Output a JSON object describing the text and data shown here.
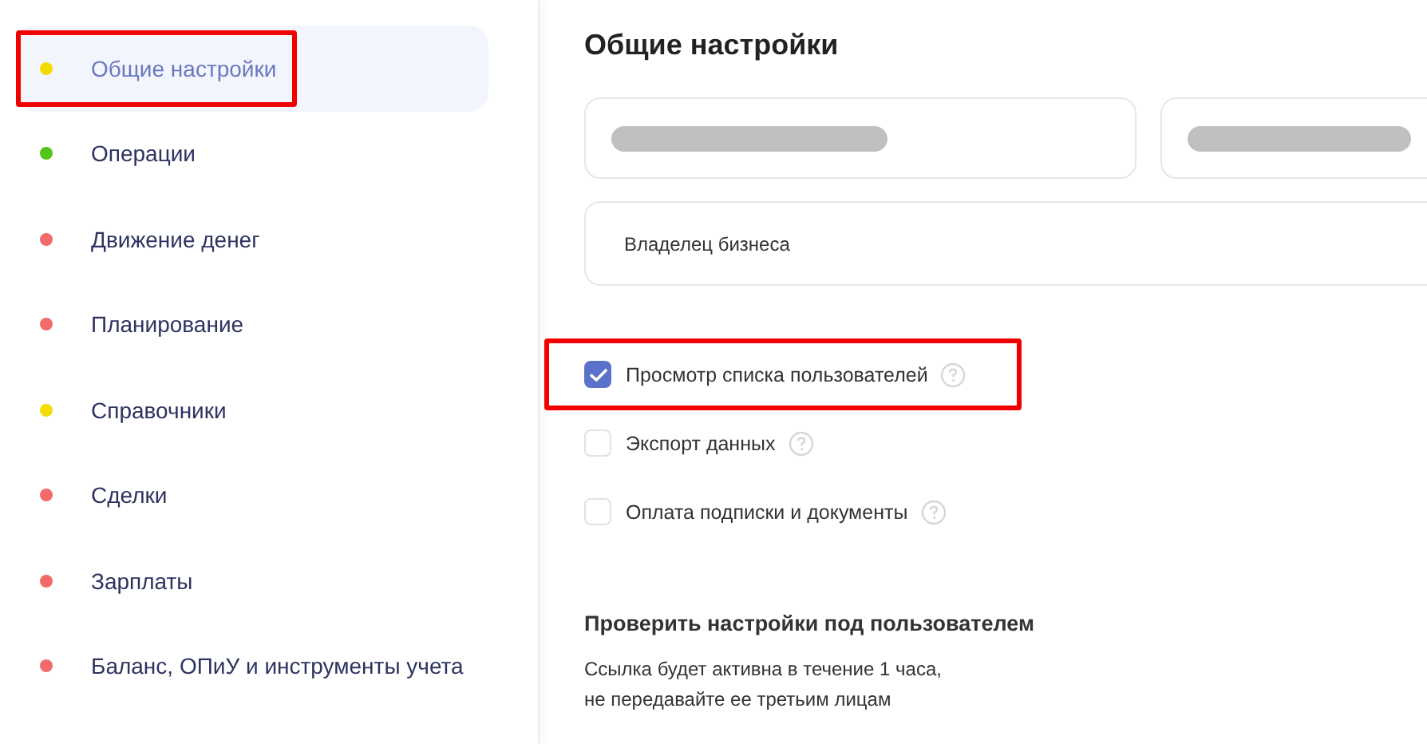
{
  "sidebar": {
    "items": [
      {
        "label": "Общие настройки",
        "color": "#f5dc00",
        "selected": true,
        "highlighted": true
      },
      {
        "label": "Операции",
        "color": "#52c41a",
        "selected": false,
        "highlighted": false
      },
      {
        "label": "Движение денег",
        "color": "#f26b6b",
        "selected": false,
        "highlighted": false
      },
      {
        "label": "Планирование",
        "color": "#f26b6b",
        "selected": false,
        "highlighted": false
      },
      {
        "label": "Справочники",
        "color": "#f5dc00",
        "selected": false,
        "highlighted": false
      },
      {
        "label": "Сделки",
        "color": "#f26b6b",
        "selected": false,
        "highlighted": false
      },
      {
        "label": "Зарплаты",
        "color": "#f26b6b",
        "selected": false,
        "highlighted": false
      },
      {
        "label": "Баланс, ОПиУ и инструменты учета",
        "color": "#f26b6b",
        "selected": false,
        "highlighted": false
      }
    ]
  },
  "main": {
    "title": "Общие настройки",
    "fields": [
      {
        "kind": "loading"
      },
      {
        "kind": "loading"
      },
      {
        "kind": "text",
        "value": "Владелец бизнеса"
      }
    ],
    "permissions": [
      {
        "label": "Просмотр списка пользователей",
        "checked": true,
        "highlighted": true
      },
      {
        "label": "Экспорт данных",
        "checked": false,
        "highlighted": false
      },
      {
        "label": "Оплата подписки и документы",
        "checked": false,
        "highlighted": false
      }
    ],
    "check_section": {
      "title": "Проверить настройки под пользователем",
      "lines": [
        "Ссылка будет активна в течение 1 часа,",
        "не передавайте ее третьим лицам"
      ]
    }
  }
}
